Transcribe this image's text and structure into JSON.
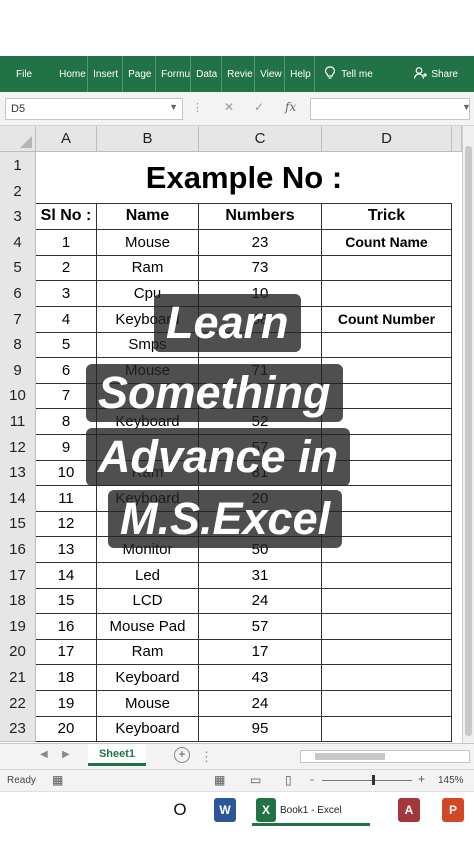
{
  "ribbon": {
    "tabs": [
      "File",
      "Home",
      "Insert",
      "Page",
      "Formu",
      "Data",
      "Revie",
      "View",
      "Help"
    ],
    "tell_me": "Tell me",
    "share": "Share",
    "bg_color": "#217346"
  },
  "formula_bar": {
    "name_box": "D5",
    "cancel_icon": "✕",
    "enter_icon": "✓",
    "fx_icon": "fx",
    "value": ""
  },
  "columns": [
    "A",
    "B",
    "C",
    "D"
  ],
  "rows": [
    "1",
    "2",
    "3",
    "4",
    "5",
    "6",
    "7",
    "8",
    "9",
    "10",
    "11",
    "12",
    "13",
    "14",
    "15",
    "16",
    "17",
    "18",
    "19",
    "20",
    "21",
    "22",
    "23"
  ],
  "title": "Example No :",
  "headers": {
    "a": "Sl No :",
    "b": "Name",
    "c": "Numbers",
    "d": "Trick"
  },
  "trick": {
    "count_name": "Count Name",
    "count_number": "Count Number"
  },
  "table": [
    [
      "1",
      "Mouse",
      "23"
    ],
    [
      "2",
      "Ram",
      "73"
    ],
    [
      "3",
      "Cpu",
      "10"
    ],
    [
      "4",
      "Keyboard",
      "68"
    ],
    [
      "5",
      "Smps",
      ""
    ],
    [
      "6",
      "Mouse",
      "71"
    ],
    [
      "7",
      "",
      ""
    ],
    [
      "8",
      "Keyboard",
      "52"
    ],
    [
      "9",
      "",
      "57"
    ],
    [
      "10",
      "Ram",
      "81"
    ],
    [
      "11",
      "Keyboard",
      "20"
    ],
    [
      "12",
      "",
      ""
    ],
    [
      "13",
      "Monitor",
      "50"
    ],
    [
      "14",
      "Led",
      "31"
    ],
    [
      "15",
      "LCD",
      "24"
    ],
    [
      "16",
      "Mouse Pad",
      "57"
    ],
    [
      "17",
      "Ram",
      "17"
    ],
    [
      "18",
      "Keyboard",
      "43"
    ],
    [
      "19",
      "Mouse",
      "24"
    ],
    [
      "20",
      "Keyboard",
      "95"
    ]
  ],
  "overlay": {
    "line1": "Learn",
    "line2": "Something",
    "line3": "Advance in",
    "line4": "M.S.Excel"
  },
  "sheet_tab": "Sheet1",
  "status": {
    "ready": "Ready",
    "zoom": "145%",
    "minus": "-",
    "plus": "+"
  },
  "taskbar": {
    "start_icon": "O",
    "word_icon": "W",
    "excel_icon": "X",
    "excel_label": "Book1 - Excel",
    "access_icon": "A",
    "ppt_icon": "P"
  }
}
